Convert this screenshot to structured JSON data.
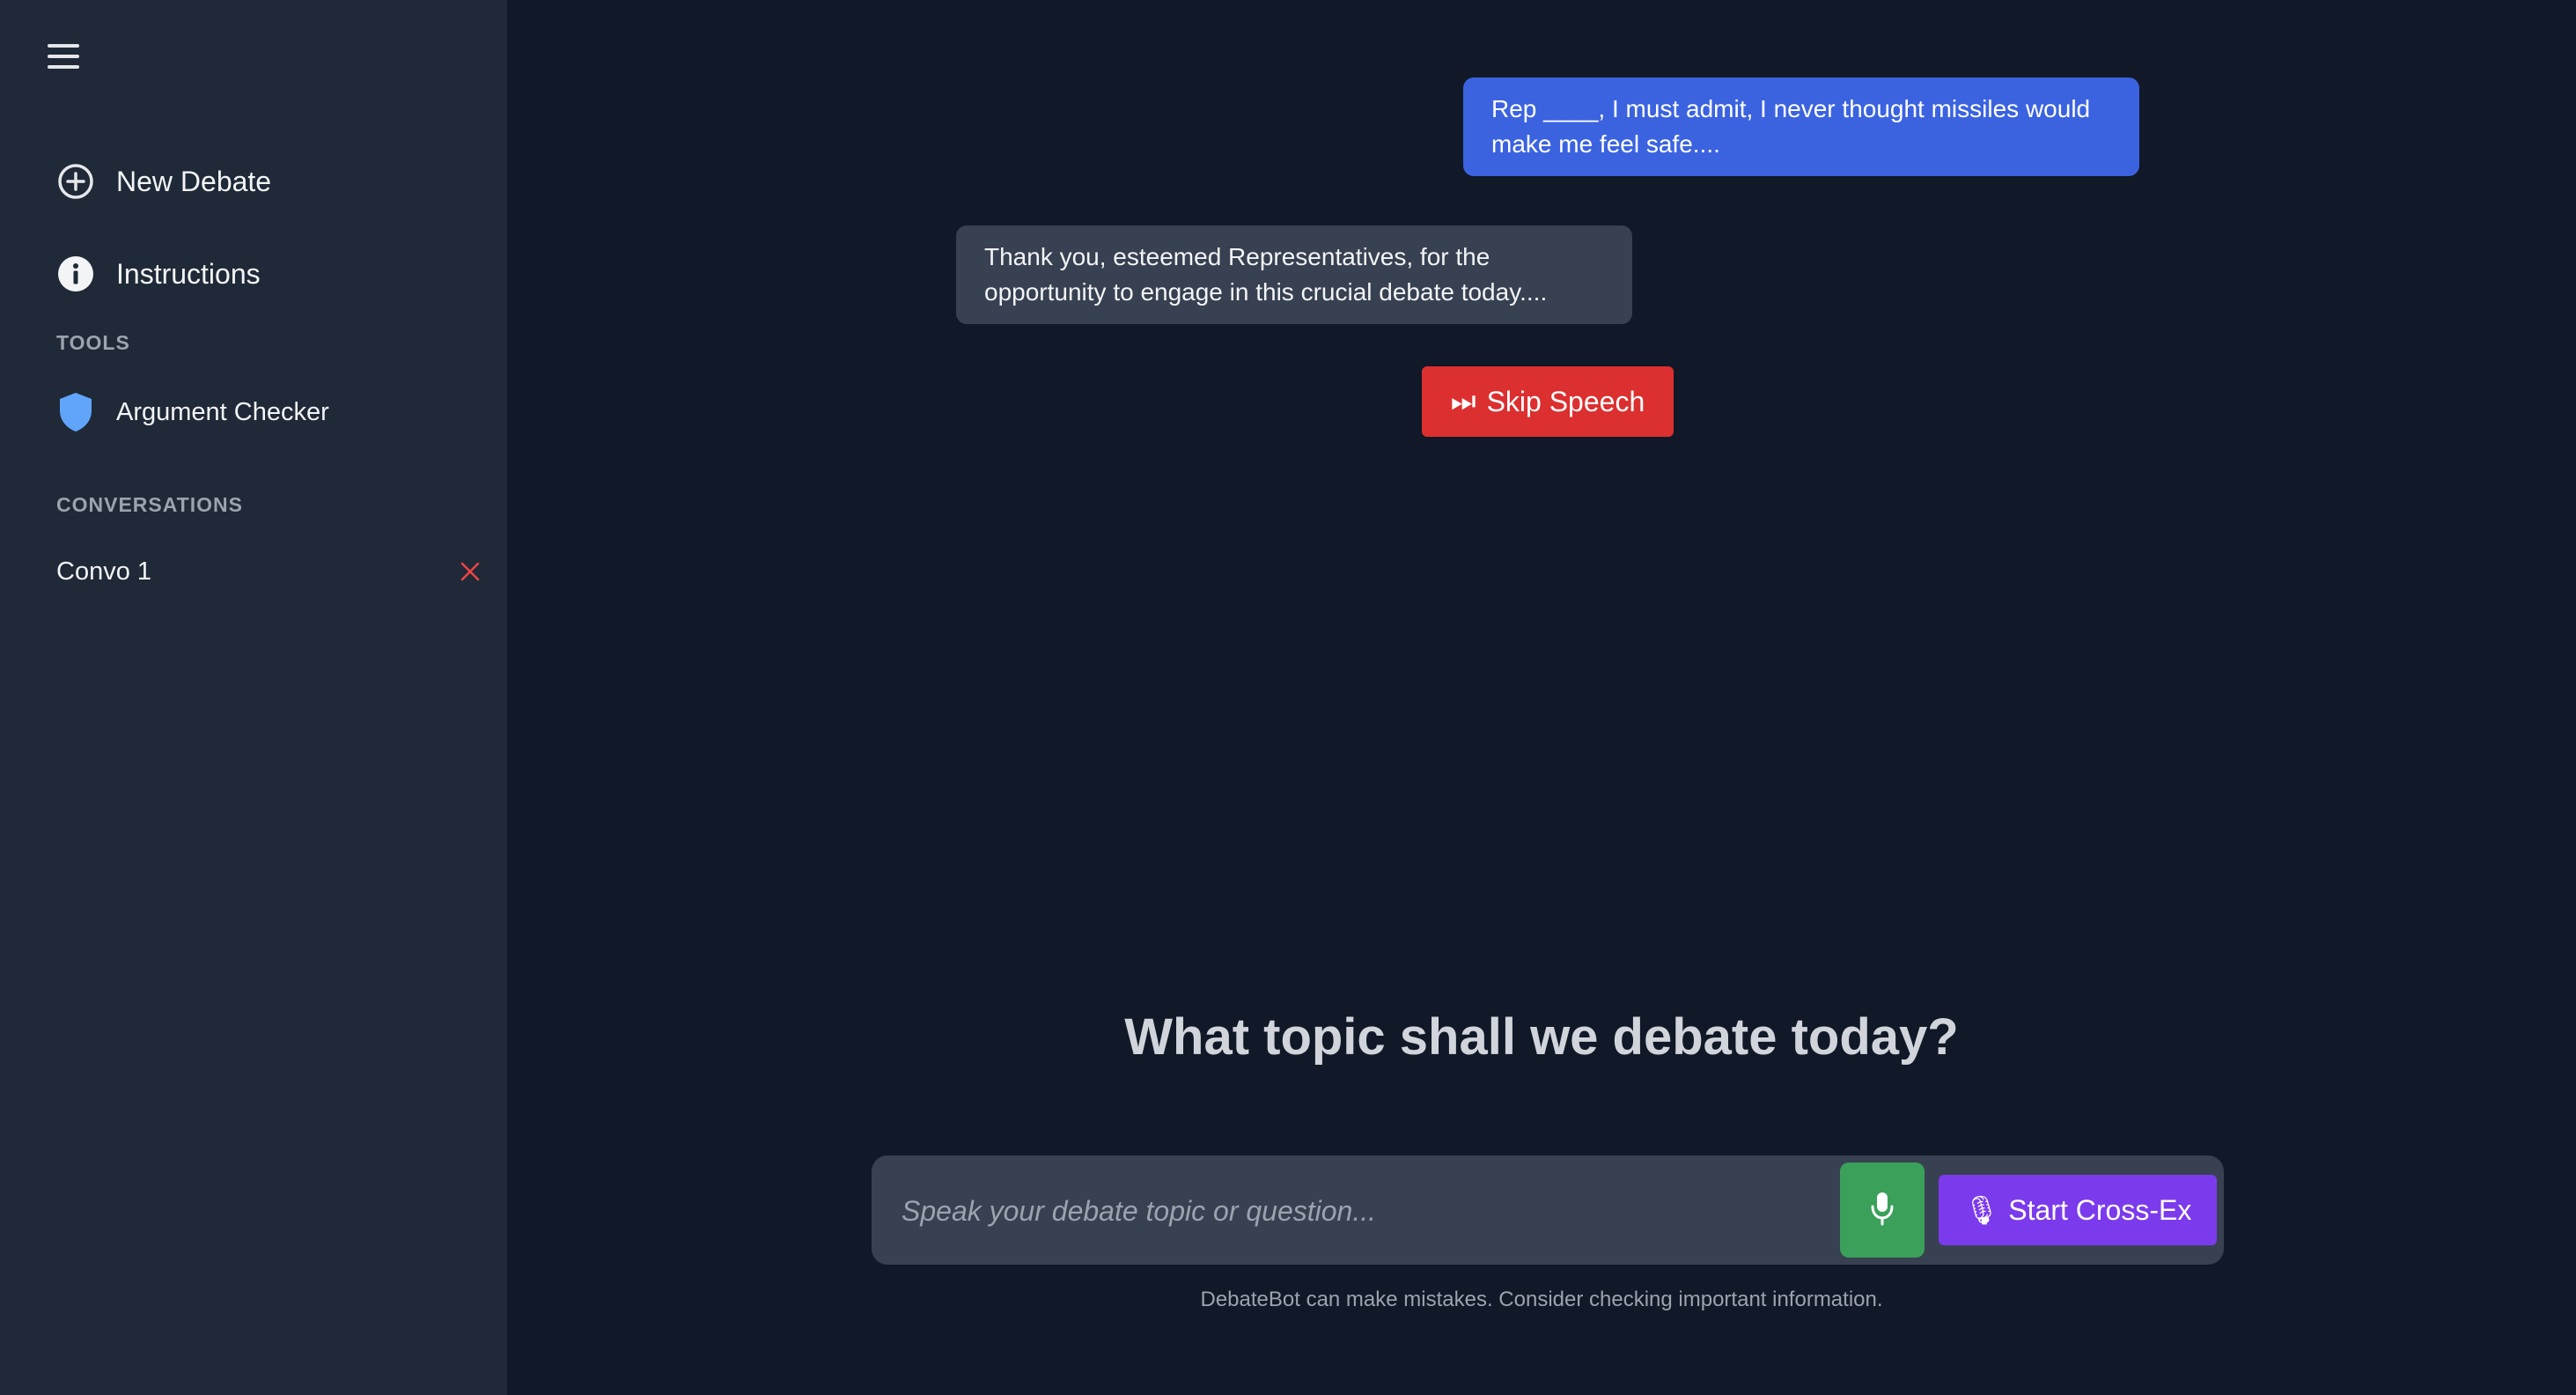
{
  "sidebar": {
    "menu_icon": "hamburger-menu-icon",
    "nav": [
      {
        "label": "New Debate",
        "icon": "plus-circle-icon"
      },
      {
        "label": "Instructions",
        "icon": "info-circle-icon"
      }
    ],
    "tools_label": "TOOLS",
    "tools": [
      {
        "label": "Argument Checker",
        "icon": "shield-icon"
      }
    ],
    "conversations_label": "CONVERSATIONS",
    "conversations": [
      {
        "label": "Convo 1",
        "icon": "close-icon"
      }
    ]
  },
  "chat": {
    "messages": [
      {
        "role": "user",
        "text": "Rep ____, I must admit, I never thought missiles would make me feel safe...."
      },
      {
        "role": "bot",
        "text": "Thank you, esteemed Representatives, for the opportunity to engage in this crucial debate today...."
      }
    ],
    "skip_button": {
      "icon": "⏭",
      "label": "Skip Speech"
    }
  },
  "main": {
    "headline": "What topic shall we debate today?",
    "input_placeholder": "Speak your debate topic or question...",
    "mic_icon": "microphone-icon",
    "crossex_button": {
      "icon": "🎙",
      "label": "Start Cross-Ex"
    },
    "disclaimer": "DebateBot can make mistakes. Consider checking important information."
  },
  "colors": {
    "background": "#111827",
    "sidebar": "#1f2937",
    "user_bubble": "#3b63e0",
    "bot_bubble": "#374151",
    "skip_button": "#dc2f2f",
    "mic_button": "#3aa05a",
    "crossex_button": "#7c3aed",
    "close_icon": "#ef4444",
    "shield_icon": "#60a5fa"
  }
}
